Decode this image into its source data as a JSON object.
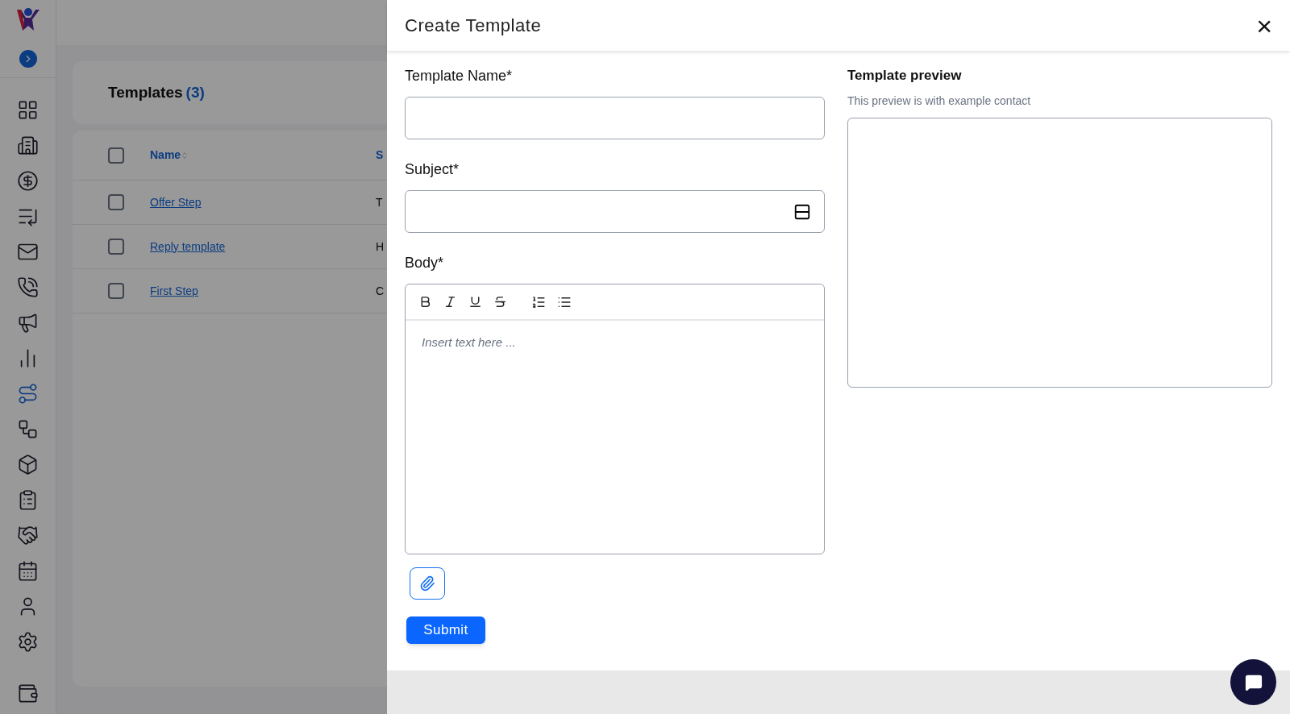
{
  "sidebar": {
    "items": [
      {
        "selected": false
      },
      {
        "selected": false
      },
      {
        "selected": false
      },
      {
        "selected": false
      },
      {
        "selected": false
      },
      {
        "selected": false
      },
      {
        "selected": false
      },
      {
        "selected": false
      },
      {
        "selected": true
      },
      {
        "selected": false
      },
      {
        "selected": false
      },
      {
        "selected": false
      },
      {
        "selected": false
      },
      {
        "selected": false
      },
      {
        "selected": false
      },
      {
        "selected": false
      }
    ]
  },
  "page": {
    "title": "Templates",
    "count": "(3)"
  },
  "table": {
    "select_all": {
      "checked": false
    },
    "columns": [
      {
        "label": "Name"
      },
      {
        "label": "S"
      }
    ],
    "rows": [
      {
        "checked": false,
        "name": "Offer Step",
        "column_2": "T"
      },
      {
        "checked": false,
        "name": "Reply template",
        "column_2": "H"
      },
      {
        "checked": false,
        "name": "First Step",
        "column_2": "C"
      }
    ]
  },
  "drawer": {
    "title": "Create Template",
    "close": "×",
    "fields": [
      {
        "kind": "text",
        "label": "Template Name*"
      },
      {
        "kind": "subject",
        "label": "Subject*"
      }
    ],
    "body": {
      "label": "Body*",
      "placeholder": "Insert text here ..."
    },
    "submit": "Submit",
    "preview": {
      "title": "Template preview",
      "subtitle": "This preview is with example contact"
    }
  }
}
